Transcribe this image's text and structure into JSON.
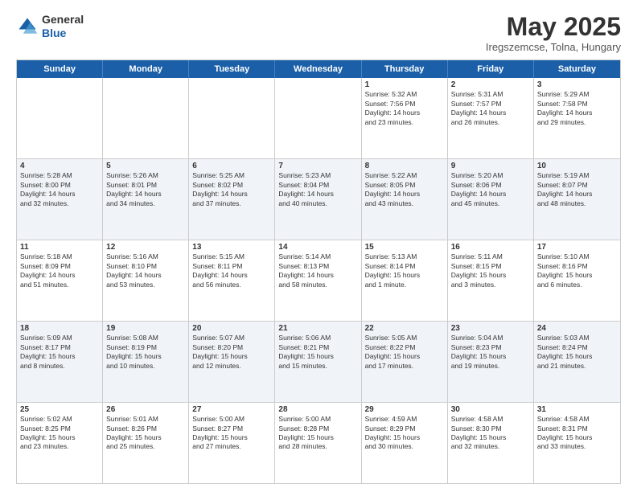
{
  "logo": {
    "general": "General",
    "blue": "Blue"
  },
  "header": {
    "month": "May 2025",
    "location": "Iregszemcse, Tolna, Hungary"
  },
  "days": [
    "Sunday",
    "Monday",
    "Tuesday",
    "Wednesday",
    "Thursday",
    "Friday",
    "Saturday"
  ],
  "weeks": [
    [
      {
        "day": "",
        "info": ""
      },
      {
        "day": "",
        "info": ""
      },
      {
        "day": "",
        "info": ""
      },
      {
        "day": "",
        "info": ""
      },
      {
        "day": "1",
        "info": "Sunrise: 5:32 AM\nSunset: 7:56 PM\nDaylight: 14 hours\nand 23 minutes."
      },
      {
        "day": "2",
        "info": "Sunrise: 5:31 AM\nSunset: 7:57 PM\nDaylight: 14 hours\nand 26 minutes."
      },
      {
        "day": "3",
        "info": "Sunrise: 5:29 AM\nSunset: 7:58 PM\nDaylight: 14 hours\nand 29 minutes."
      }
    ],
    [
      {
        "day": "4",
        "info": "Sunrise: 5:28 AM\nSunset: 8:00 PM\nDaylight: 14 hours\nand 32 minutes."
      },
      {
        "day": "5",
        "info": "Sunrise: 5:26 AM\nSunset: 8:01 PM\nDaylight: 14 hours\nand 34 minutes."
      },
      {
        "day": "6",
        "info": "Sunrise: 5:25 AM\nSunset: 8:02 PM\nDaylight: 14 hours\nand 37 minutes."
      },
      {
        "day": "7",
        "info": "Sunrise: 5:23 AM\nSunset: 8:04 PM\nDaylight: 14 hours\nand 40 minutes."
      },
      {
        "day": "8",
        "info": "Sunrise: 5:22 AM\nSunset: 8:05 PM\nDaylight: 14 hours\nand 43 minutes."
      },
      {
        "day": "9",
        "info": "Sunrise: 5:20 AM\nSunset: 8:06 PM\nDaylight: 14 hours\nand 45 minutes."
      },
      {
        "day": "10",
        "info": "Sunrise: 5:19 AM\nSunset: 8:07 PM\nDaylight: 14 hours\nand 48 minutes."
      }
    ],
    [
      {
        "day": "11",
        "info": "Sunrise: 5:18 AM\nSunset: 8:09 PM\nDaylight: 14 hours\nand 51 minutes."
      },
      {
        "day": "12",
        "info": "Sunrise: 5:16 AM\nSunset: 8:10 PM\nDaylight: 14 hours\nand 53 minutes."
      },
      {
        "day": "13",
        "info": "Sunrise: 5:15 AM\nSunset: 8:11 PM\nDaylight: 14 hours\nand 56 minutes."
      },
      {
        "day": "14",
        "info": "Sunrise: 5:14 AM\nSunset: 8:13 PM\nDaylight: 14 hours\nand 58 minutes."
      },
      {
        "day": "15",
        "info": "Sunrise: 5:13 AM\nSunset: 8:14 PM\nDaylight: 15 hours\nand 1 minute."
      },
      {
        "day": "16",
        "info": "Sunrise: 5:11 AM\nSunset: 8:15 PM\nDaylight: 15 hours\nand 3 minutes."
      },
      {
        "day": "17",
        "info": "Sunrise: 5:10 AM\nSunset: 8:16 PM\nDaylight: 15 hours\nand 6 minutes."
      }
    ],
    [
      {
        "day": "18",
        "info": "Sunrise: 5:09 AM\nSunset: 8:17 PM\nDaylight: 15 hours\nand 8 minutes."
      },
      {
        "day": "19",
        "info": "Sunrise: 5:08 AM\nSunset: 8:19 PM\nDaylight: 15 hours\nand 10 minutes."
      },
      {
        "day": "20",
        "info": "Sunrise: 5:07 AM\nSunset: 8:20 PM\nDaylight: 15 hours\nand 12 minutes."
      },
      {
        "day": "21",
        "info": "Sunrise: 5:06 AM\nSunset: 8:21 PM\nDaylight: 15 hours\nand 15 minutes."
      },
      {
        "day": "22",
        "info": "Sunrise: 5:05 AM\nSunset: 8:22 PM\nDaylight: 15 hours\nand 17 minutes."
      },
      {
        "day": "23",
        "info": "Sunrise: 5:04 AM\nSunset: 8:23 PM\nDaylight: 15 hours\nand 19 minutes."
      },
      {
        "day": "24",
        "info": "Sunrise: 5:03 AM\nSunset: 8:24 PM\nDaylight: 15 hours\nand 21 minutes."
      }
    ],
    [
      {
        "day": "25",
        "info": "Sunrise: 5:02 AM\nSunset: 8:25 PM\nDaylight: 15 hours\nand 23 minutes."
      },
      {
        "day": "26",
        "info": "Sunrise: 5:01 AM\nSunset: 8:26 PM\nDaylight: 15 hours\nand 25 minutes."
      },
      {
        "day": "27",
        "info": "Sunrise: 5:00 AM\nSunset: 8:27 PM\nDaylight: 15 hours\nand 27 minutes."
      },
      {
        "day": "28",
        "info": "Sunrise: 5:00 AM\nSunset: 8:28 PM\nDaylight: 15 hours\nand 28 minutes."
      },
      {
        "day": "29",
        "info": "Sunrise: 4:59 AM\nSunset: 8:29 PM\nDaylight: 15 hours\nand 30 minutes."
      },
      {
        "day": "30",
        "info": "Sunrise: 4:58 AM\nSunset: 8:30 PM\nDaylight: 15 hours\nand 32 minutes."
      },
      {
        "day": "31",
        "info": "Sunrise: 4:58 AM\nSunset: 8:31 PM\nDaylight: 15 hours\nand 33 minutes."
      }
    ]
  ]
}
